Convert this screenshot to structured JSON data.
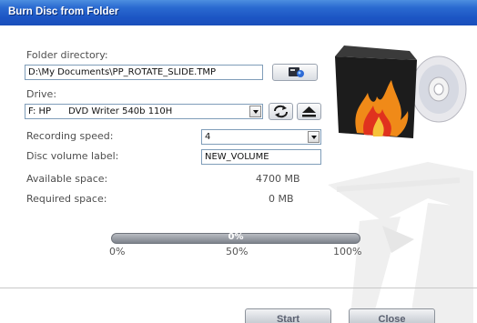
{
  "window": {
    "title": "Burn Disc from Folder"
  },
  "form": {
    "folder_label": "Folder directory:",
    "folder_value": "D:\\My Documents\\PP_ROTATE_SLIDE.TMP",
    "drive_label": "Drive:",
    "drive_value": "F: HP      DVD Writer 540b 110H",
    "speed_label": "Recording speed:",
    "speed_value": "4",
    "volume_label": "Disc volume label:",
    "volume_value": "NEW_VOLUME",
    "available_label": "Available space:",
    "available_value": "4700 MB",
    "required_label": "Required space:",
    "required_value": "0 MB"
  },
  "progress": {
    "value": 0,
    "percent_text": "0%",
    "ticks": [
      "0%",
      "50%",
      "100%"
    ]
  },
  "buttons": {
    "start": "Start",
    "close": "Close"
  },
  "colors": {
    "titlebar": "#1f5cc8",
    "accent_red": "#e0321e",
    "flame_orange": "#f08a18"
  },
  "icons": [
    "browse-folder-icon",
    "refresh-drives-icon",
    "eject-icon",
    "burn-disc-logo"
  ]
}
